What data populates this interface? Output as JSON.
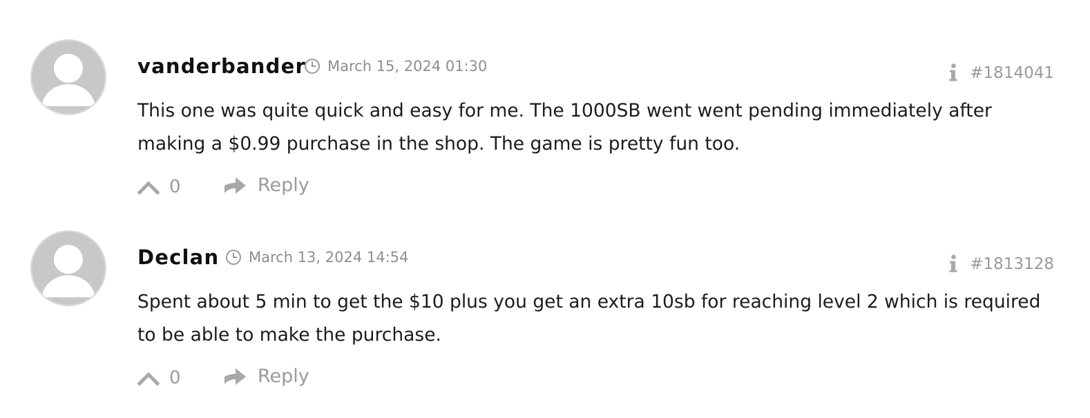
{
  "comments": [
    {
      "author": "vanderbander",
      "date": "March 15, 2024 01:30",
      "id": "#1814041",
      "text": "This one was quite quick and easy for me. The 1000SB went went pending immediately after making a $0.99 purchase in the shop. The game is pretty fun too.",
      "votes": "0",
      "reply_label": "Reply"
    },
    {
      "author": "Declan",
      "date": "March 13, 2024 14:54",
      "id": "#1813128",
      "text": "Spent about 5 min to get the $10 plus you get an extra 10sb for reaching level 2 which is required to be able to make the purchase.",
      "votes": "0",
      "reply_label": "Reply"
    }
  ],
  "icons": {
    "avatar": "avatar-placeholder-icon",
    "clock": "clock-icon",
    "info": "info-icon",
    "upvote": "chevron-up-icon",
    "reply": "reply-arrow-icon"
  },
  "colors": {
    "text": "#1c1c1c",
    "muted": "#9a9a9a",
    "icon": "#a8a8a8",
    "avatar": "#c8c8c8"
  }
}
